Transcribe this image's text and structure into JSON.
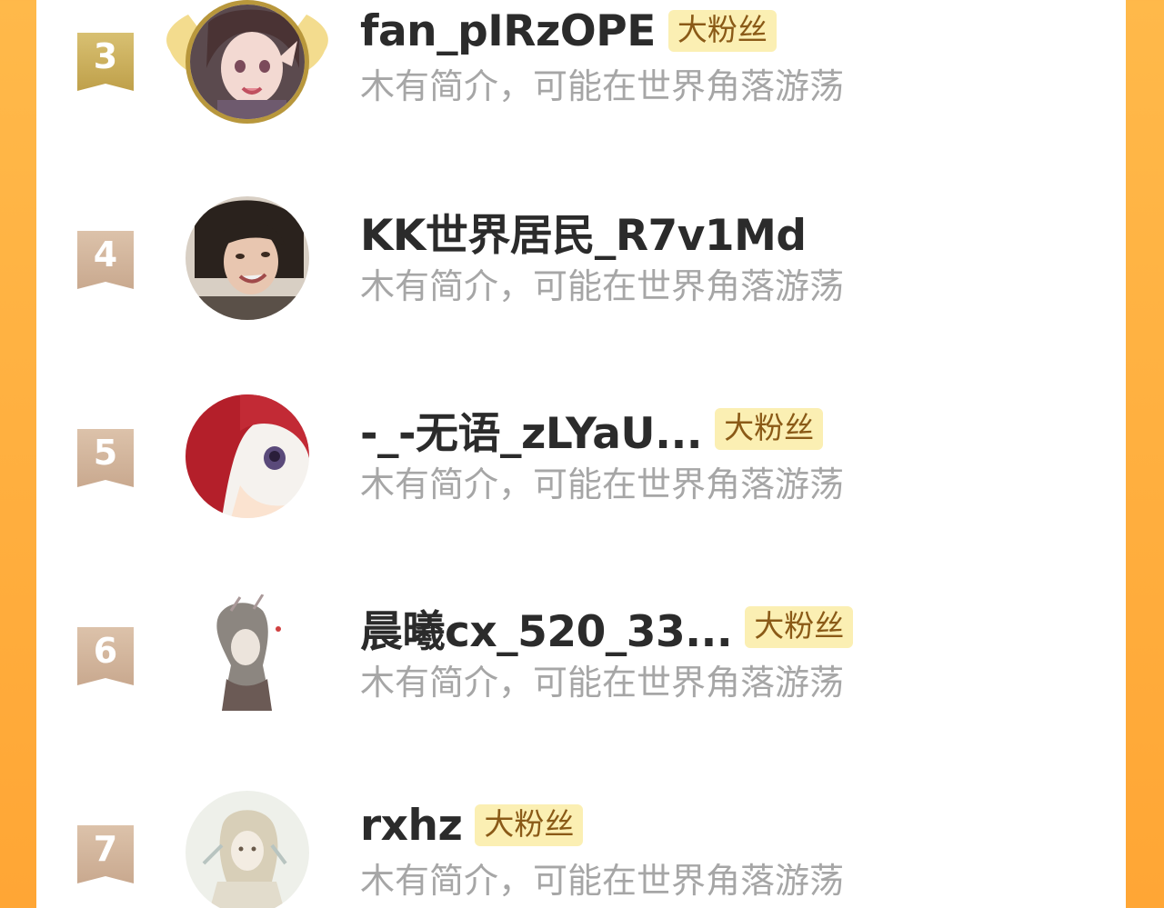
{
  "fans": [
    {
      "rank": "3",
      "name": "fan_pIRzOPE",
      "badge": "大粉丝",
      "bio": "木有简介，可能在世界角落游荡",
      "avatar_icon": "anime-girl-avatar-icon",
      "rank_color": "#c8a64a"
    },
    {
      "rank": "4",
      "name": "KK世界居民_R7v1Md",
      "badge": "",
      "bio": "木有简介，可能在世界角落游荡",
      "avatar_icon": "photo-portrait-avatar-icon",
      "rank_color": "#d4b59a"
    },
    {
      "rank": "5",
      "name": "-_-无语_zLYaU...",
      "badge": "大粉丝",
      "bio": "木有简介，可能在世界角落游荡",
      "avatar_icon": "red-hair-anime-avatar-icon",
      "rank_color": "#d4b59a"
    },
    {
      "rank": "6",
      "name": "晨曦cx_520_33...",
      "badge": "大粉丝",
      "bio": "木有简介，可能在世界角落游荡",
      "avatar_icon": "sketch-girl-avatar-icon",
      "rank_color": "#d4b59a"
    },
    {
      "rank": "7",
      "name": "rxhz",
      "badge": "大粉丝",
      "bio": "木有简介，可能在世界角落游荡",
      "avatar_icon": "pale-illustration-avatar-icon",
      "rank_color": "#d4b59a"
    }
  ]
}
